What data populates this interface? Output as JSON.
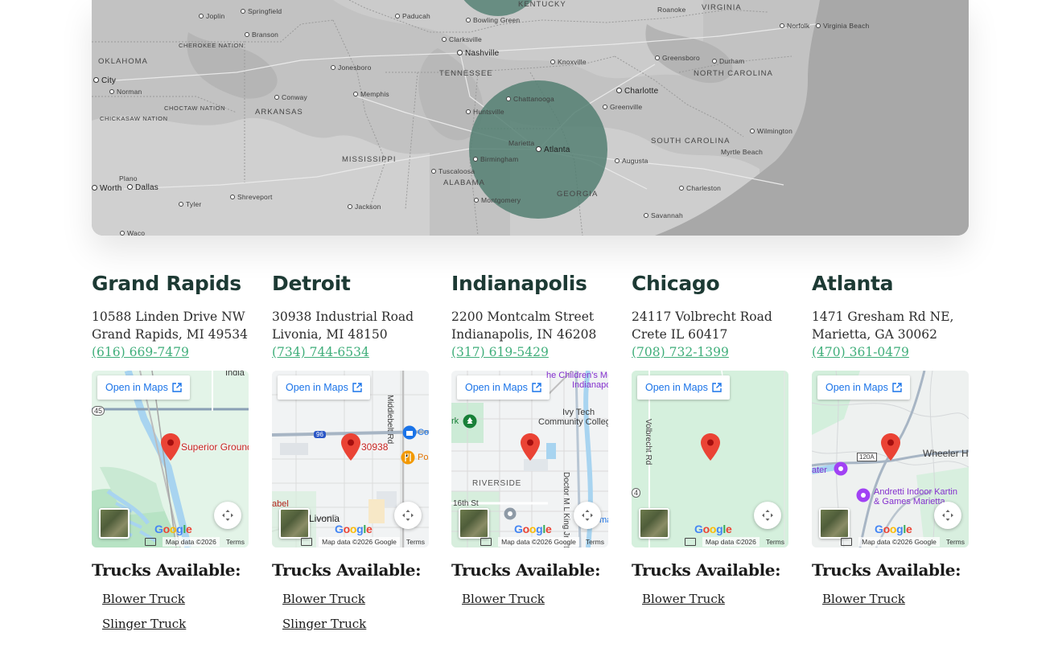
{
  "region_map": {
    "labels": {
      "kentucky": "KENTUCKY",
      "virginia": "VIRGINIA",
      "roanoke": "Roanoke",
      "norfolk": "Norfolk",
      "virginia_beach": "Virginia Beach",
      "joplin": "Joplin",
      "springfield": "Springfield",
      "paducah": "Paducah",
      "bowling_green": "Bowling Green",
      "branson": "Branson",
      "clarksville": "Clarksville",
      "cherokee_nation": "CHEROKEE NATION",
      "nashville": "Nashville",
      "greensboro": "Greensboro",
      "durham": "Durham",
      "oklahoma": "OKLAHOMA",
      "jonesboro": "Jonesboro",
      "knoxville": "Knoxville",
      "tennessee": "TENNESSEE",
      "north_carolina": "NORTH CAROLINA",
      "oklahoma_city": "City",
      "norman": "Norman",
      "memphis": "Memphis",
      "charlotte": "Charlotte",
      "conway": "Conway",
      "chattanooga": "Chattanooga",
      "greenville": "Greenville",
      "choctaw_nation": "CHOCTAW NATION",
      "arkansas": "ARKANSAS",
      "huntsville": "Huntsville",
      "chickasaw_nation": "CHICKASAW NATION",
      "wilmington": "Wilmington",
      "marietta": "Marietta",
      "atlanta": "Atlanta",
      "south_carolina": "SOUTH CAROLINA",
      "mississippi": "MISSISSIPPI",
      "birmingham": "Birmingham",
      "myrtle_beach": "Myrtle Beach",
      "augusta": "Augusta",
      "tuscaloosa": "Tuscaloosa",
      "plano": "Plano",
      "alabama": "ALABAMA",
      "charleston": "Charleston",
      "fort_worth": "Worth",
      "dallas": "Dallas",
      "georgia": "GEORGIA",
      "shreveport": "Shreveport",
      "tyler": "Tyler",
      "jackson": "Jackson",
      "montgomery": "Montgomery",
      "savannah": "Savannah",
      "waco": "Waco"
    }
  },
  "map_ui": {
    "open_in_maps": "Open in Maps",
    "map_data": "Map data ©2026",
    "map_data_google": "Map data ©2026 Google",
    "terms": "Terms",
    "google": "Google"
  },
  "trucks_heading": "Trucks Available:",
  "locations": [
    {
      "name": "Grand Rapids",
      "address_line1": "10588 Linden Drive NW",
      "address_line2": "Grand Rapids, MI 49534",
      "phone": "(616) 669-7479",
      "map_pin_label": "Superior Ground",
      "map_texts": [
        "India",
        "45"
      ],
      "attribution": "map_data",
      "trucks": [
        "Blower Truck",
        "Slinger Truck"
      ]
    },
    {
      "name": "Detroit",
      "address_line1": "30938 Industrial Road",
      "address_line2": "Livonia, MI 48150",
      "phone": "(734) 744-6534",
      "map_pin_label": "30938",
      "map_texts": [
        "Middlebelt Rd",
        "Co",
        "Po",
        "abel",
        "Livonia",
        "96"
      ],
      "attribution": "map_data_google",
      "trucks": [
        "Blower Truck",
        "Slinger Truck"
      ]
    },
    {
      "name": "Indianapolis",
      "address_line1": "2200 Montcalm Street",
      "address_line2": "Indianapolis, IN 46208",
      "phone": "(317) 619-5429",
      "map_pin_label": "",
      "map_texts": [
        "he Children's Museum",
        "Indianapolis",
        "Ivy Tech",
        "Community College",
        "rk",
        "RIVERSIDE",
        "16th St",
        "Doctor M L King Jr St",
        "ma"
      ],
      "attribution": "map_data_google",
      "trucks": [
        "Blower Truck"
      ]
    },
    {
      "name": "Chicago",
      "address_line1": "24117 Volbrecht Road",
      "address_line2": "Crete IL 60417",
      "phone": "(708) 732-1399",
      "map_pin_label": "",
      "map_texts": [
        "Volbrecht Rd",
        "4"
      ],
      "attribution": "map_data",
      "trucks": [
        "Blower Truck"
      ]
    },
    {
      "name": "Atlanta",
      "address_line1": "1471 Gresham Rd NE,",
      "address_line2": "Marietta, GA 30062",
      "phone": "(470) 361-0479",
      "map_pin_label": "",
      "map_texts": [
        "Wheeler High",
        "ater",
        "Andretti Indoor Kartin",
        "& Games Marietta",
        "120A"
      ],
      "attribution": "map_data_google",
      "trucks": [
        "Blower Truck"
      ]
    }
  ],
  "colors": {
    "heading": "#1d3a34",
    "phone_link": "#3fae7a",
    "service_circle": "#4f7d6f",
    "map_link": "#1a73e8",
    "pin": "#ea4335"
  }
}
